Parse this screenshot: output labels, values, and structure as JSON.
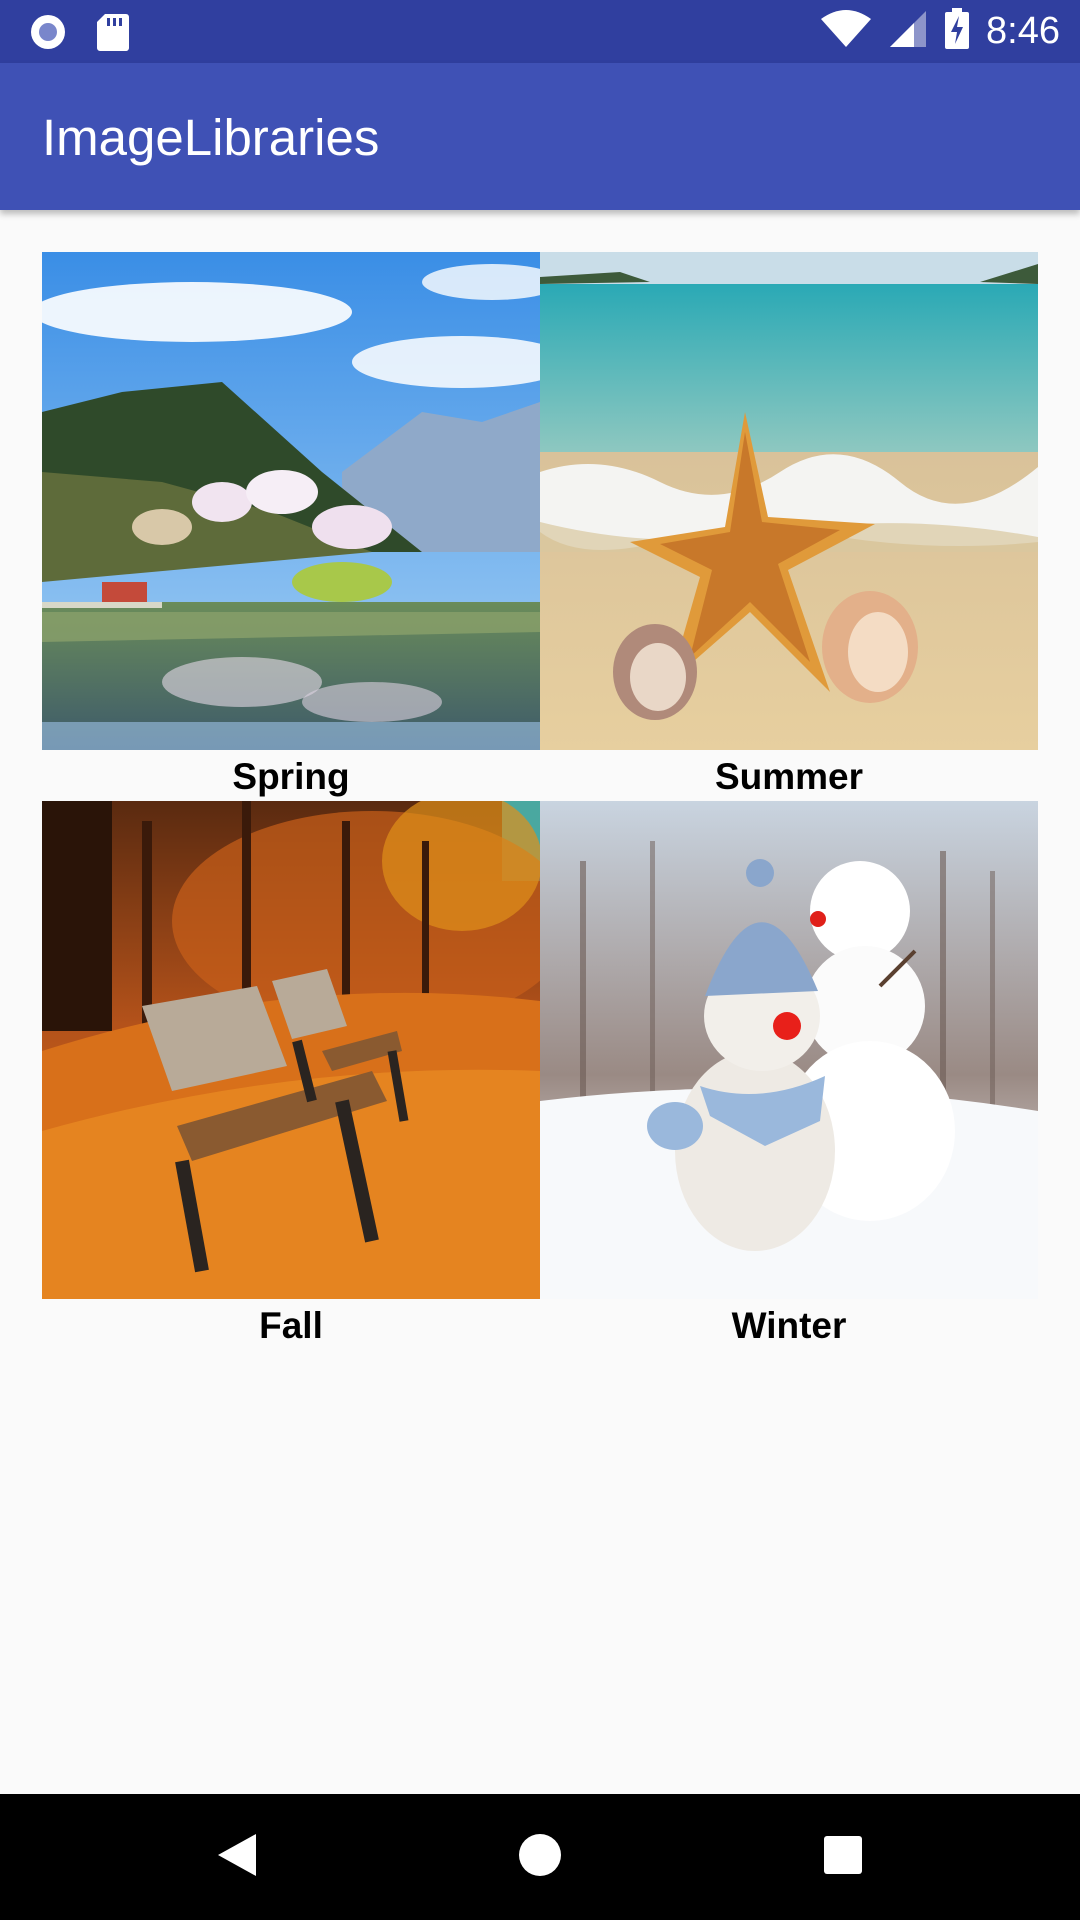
{
  "status_bar": {
    "time": "8:46",
    "icons": [
      "record-icon",
      "sd-card-icon",
      "wifi-icon",
      "signal-icon",
      "battery-charging-icon"
    ]
  },
  "app_bar": {
    "title": "ImageLibraries"
  },
  "grid": {
    "items": [
      {
        "label": "Spring",
        "image": "mountain-lake-landscape"
      },
      {
        "label": "Summer",
        "image": "starfish-on-beach"
      },
      {
        "label": "Fall",
        "image": "benches-in-autumn-park"
      },
      {
        "label": "Winter",
        "image": "snowman-toys-in-snow"
      }
    ]
  },
  "nav_bar": {
    "buttons": [
      "back-icon",
      "home-icon",
      "recents-icon"
    ]
  },
  "colors": {
    "status_bar": "#303f9f",
    "app_bar": "#3f51b5",
    "background": "#fafafa"
  }
}
